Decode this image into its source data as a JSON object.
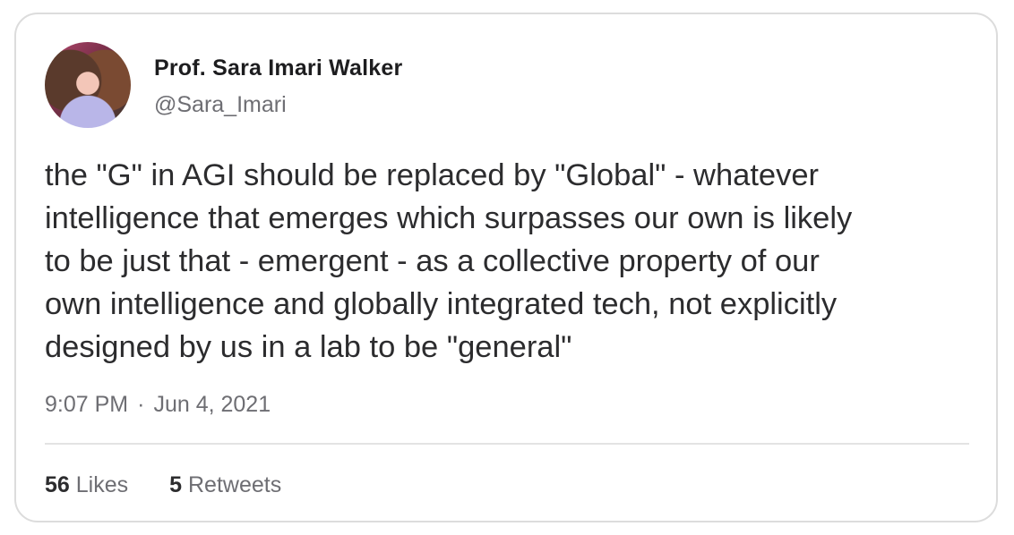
{
  "author": {
    "name": "Prof. Sara Imari Walker",
    "handle": "@Sara_Imari"
  },
  "tweet": {
    "lines": [
      "the \"G\" in AGI should be replaced by \"Global\" - whatever",
      "intelligence that emerges which surpasses our own is likely",
      "to be just that - emergent - as a collective property of our",
      "own intelligence and globally integrated tech, not explicitly",
      "designed by us in a lab to be \"general\""
    ],
    "time": "9:07 PM",
    "separator": "·",
    "date": "Jun 4, 2021"
  },
  "stats": {
    "likes_count": "56",
    "likes_label": "Likes",
    "retweets_count": "5",
    "retweets_label": "Retweets"
  }
}
